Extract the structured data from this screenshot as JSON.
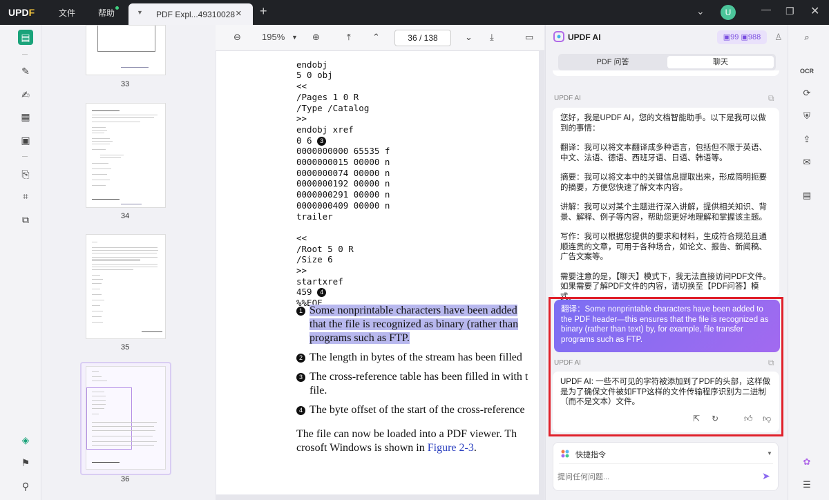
{
  "titlebar": {
    "logo_main": "UPD",
    "logo_accent": "F",
    "menu_file": "文件",
    "menu_help": "帮助",
    "tab_title": "PDF Expl...49310028",
    "avatar": "U"
  },
  "toolbar": {
    "zoom": "195%",
    "page_current": "36",
    "page_sep": "/",
    "page_total": "138"
  },
  "thumbs": [
    {
      "num": "33"
    },
    {
      "num": "34"
    },
    {
      "num": "35"
    },
    {
      "num": "36"
    }
  ],
  "code": [
    "endobj",
    "5 0 obj",
    "<<",
    "/Pages 1 0 R",
    "/Type /Catalog",
    ">>",
    "endobj xref",
    "0 6",
    "0000000000 65535 f",
    "0000000015 00000 n",
    "0000000074 00000 n",
    "0000000192 00000 n",
    "0000000291 00000 n",
    "0000000409 00000 n",
    "trailer",
    "",
    "<<",
    "/Root 5 0 R",
    "/Size 6",
    ">>",
    "startxref",
    "459",
    "%%EOF"
  ],
  "markers": {
    "m3": "3",
    "m4": "4",
    "n1": "1",
    "n2": "2",
    "n3": "3",
    "n4": "4"
  },
  "body": {
    "l1": "Some nonprintable characters have been added",
    "l2": "that the file is recognized as binary (rather than",
    "l3": "programs such as FTP.",
    "l4": "The length in bytes of the stream has been filled",
    "l5": "The cross-reference table has been filled in with t",
    "l6": "file.",
    "l7": "The byte offset of the start of the cross-reference",
    "l8": "The file can now be loaded into a PDF viewer. Th",
    "l9a": "crosoft Windows is shown in ",
    "l9link": "Figure 2-3",
    "l9b": "."
  },
  "ai": {
    "title": "UPDF AI",
    "credit_a": "99",
    "credit_b": "988",
    "seg_pdf": "PDF 问答",
    "seg_chat": "聊天",
    "tag": "UPDF AI",
    "intro": "您好，我是UPDF AI，您的文档智能助手。以下是我可以做到的事情：",
    "p1": "翻译：我可以将文本翻译成多种语言，包括但不限于英语、中文、法语、德语、西班牙语、日语、韩语等。",
    "p2": "摘要：我可以将文本中的关键信息提取出来，形成简明扼要的摘要，方便您快速了解文本内容。",
    "p3": "讲解：我可以对某个主题进行深入讲解，提供相关知识、背景、解释、例子等内容，帮助您更好地理解和掌握该主题。",
    "p4": "写作：我可以根据您提供的要求和材料，生成符合规范且通顺连贯的文章，可用于各种场合，如论文、报告、新闻稿、广告文案等。",
    "p5": "需要注意的是，【聊天】模式下，我无法直接访问PDF文件。如果需要了解PDF文件的内容，请切换至【PDF问答】模式。",
    "user_msg": "翻译：Some nonprintable characters have been added to the PDF header—this ensures that the file is recognized as binary (rather than text) by, for example, file transfer programs such as FTP.",
    "tag2": "UPDF AI",
    "answer": "UPDF AI: 一些不可见的字符被添加到了PDF的头部，这样做是为了确保文件被如FTP这样的文件传输程序识别为二进制（而不是文本）文件。",
    "quick_label": "快捷指令",
    "input_placeholder": "提问任何问题..."
  },
  "colors": {
    "accent": "#1aa37a",
    "ai_purple": "#7b6ff2",
    "highlight": "#b8b8ee",
    "red_box": "#e0202a"
  }
}
